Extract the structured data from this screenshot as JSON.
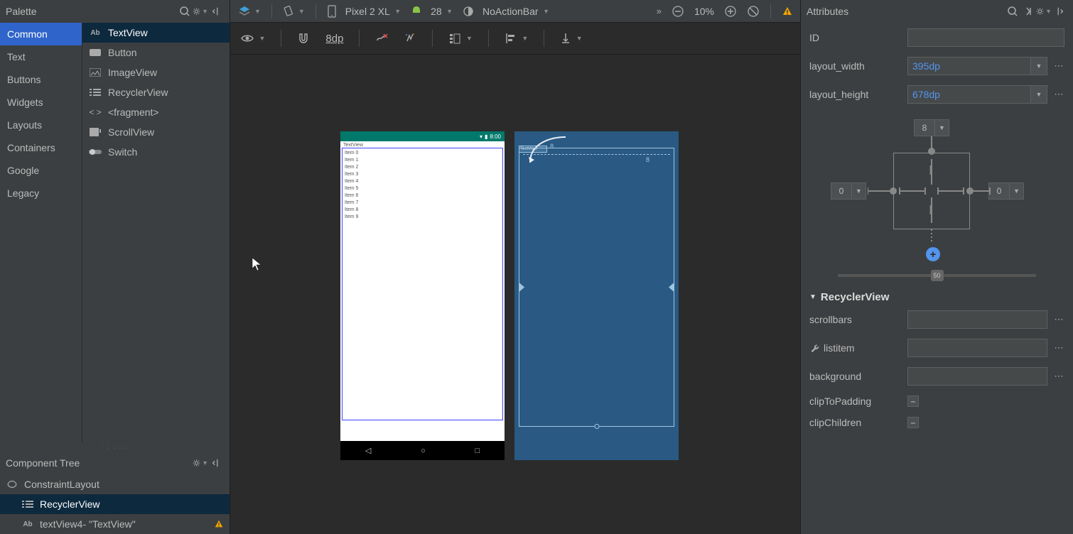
{
  "palette": {
    "title": "Palette",
    "categories": [
      "Common",
      "Text",
      "Buttons",
      "Widgets",
      "Layouts",
      "Containers",
      "Google",
      "Legacy"
    ],
    "activeCategory": 0,
    "items": [
      "TextView",
      "Button",
      "ImageView",
      "RecyclerView",
      "<fragment>",
      "ScrollView",
      "Switch"
    ],
    "activeItem": 0
  },
  "componentTree": {
    "title": "Component Tree",
    "nodes": [
      {
        "label": "ConstraintLayout",
        "icon": "constraint",
        "indent": 0,
        "active": false,
        "warn": false
      },
      {
        "label": "RecyclerView",
        "icon": "list",
        "indent": 1,
        "active": true,
        "warn": false
      },
      {
        "label": "textView4- \"TextView\"",
        "icon": "ab",
        "indent": 1,
        "active": false,
        "warn": true
      }
    ]
  },
  "toolbar1": {
    "device": "Pixel 2 XL",
    "api": "28",
    "theme": "NoActionBar",
    "zoom": "10%"
  },
  "toolbar2": {
    "gridValue": "8dp"
  },
  "designPreview": {
    "textViewLabel": "TextView",
    "statusTime": "8:00",
    "items": [
      "Item 0",
      "Item 1",
      "Item 2",
      "Item 3",
      "Item 4",
      "Item 5",
      "Item 6",
      "Item 7",
      "Item 8",
      "Item 9"
    ]
  },
  "blueprint": {
    "textViewLabel": "TextView",
    "marginTop": "8",
    "marginHint": "8"
  },
  "attributes": {
    "title": "Attributes",
    "id_label": "ID",
    "id_value": "",
    "layout_width_label": "layout_width",
    "layout_width_value": "395dp",
    "layout_height_label": "layout_height",
    "layout_height_value": "678dp",
    "constraint_top": "8",
    "constraint_left": "0",
    "constraint_right": "0",
    "bias": "50",
    "section": "RecyclerView",
    "scrollbars_label": "scrollbars",
    "scrollbars_value": "",
    "listitem_label": "listitem",
    "listitem_value": "",
    "background_label": "background",
    "background_value": "",
    "clipToPadding_label": "clipToPadding",
    "clipChildren_label": "clipChildren"
  }
}
